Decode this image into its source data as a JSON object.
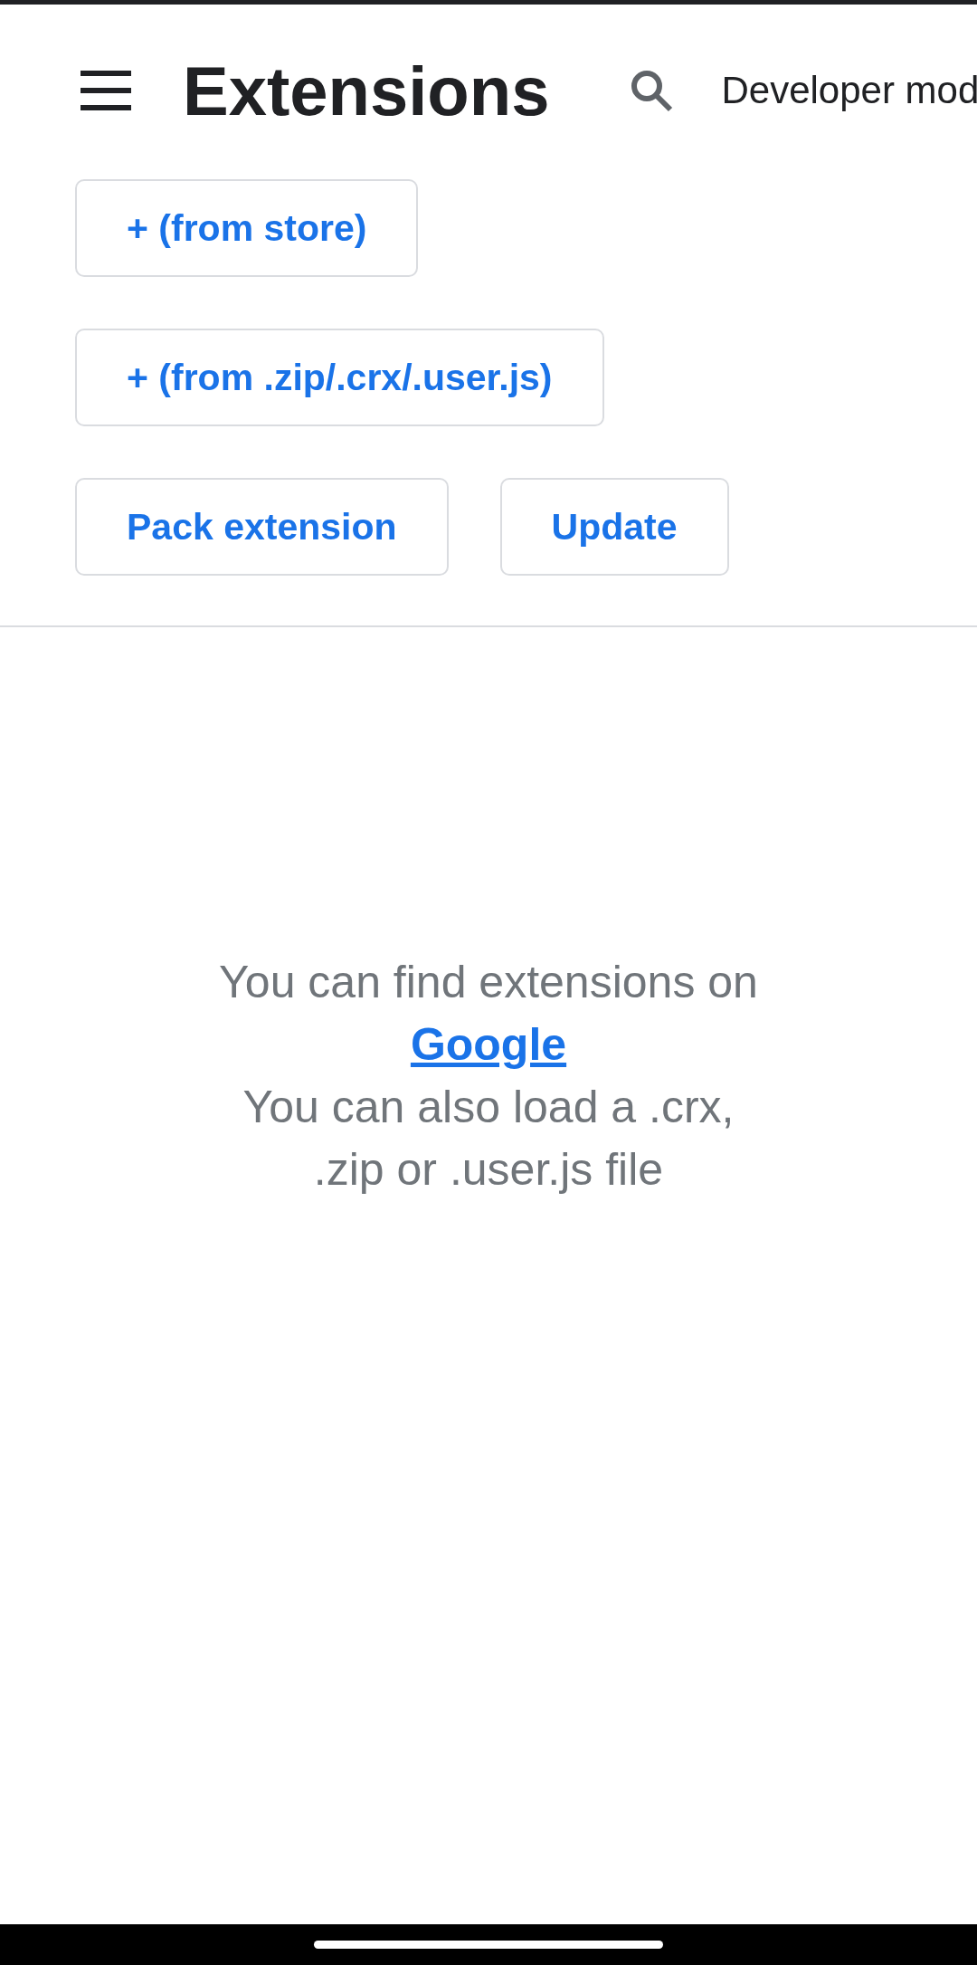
{
  "app_bar": {
    "title": "Extensions",
    "developer_mode_label": "Developer mod"
  },
  "button_rows": [
    [
      {
        "label": "+ (from store)"
      }
    ],
    [
      {
        "label": "+ (from .zip/.crx/.user.js)"
      }
    ],
    [
      {
        "label": "Pack extension"
      },
      {
        "label": "Update"
      }
    ]
  ],
  "empty_state": {
    "line_1": "You can find extensions on",
    "link": "Google",
    "line_2": "You can also load a .crx,",
    "line_3": ".zip or .user.js file"
  }
}
